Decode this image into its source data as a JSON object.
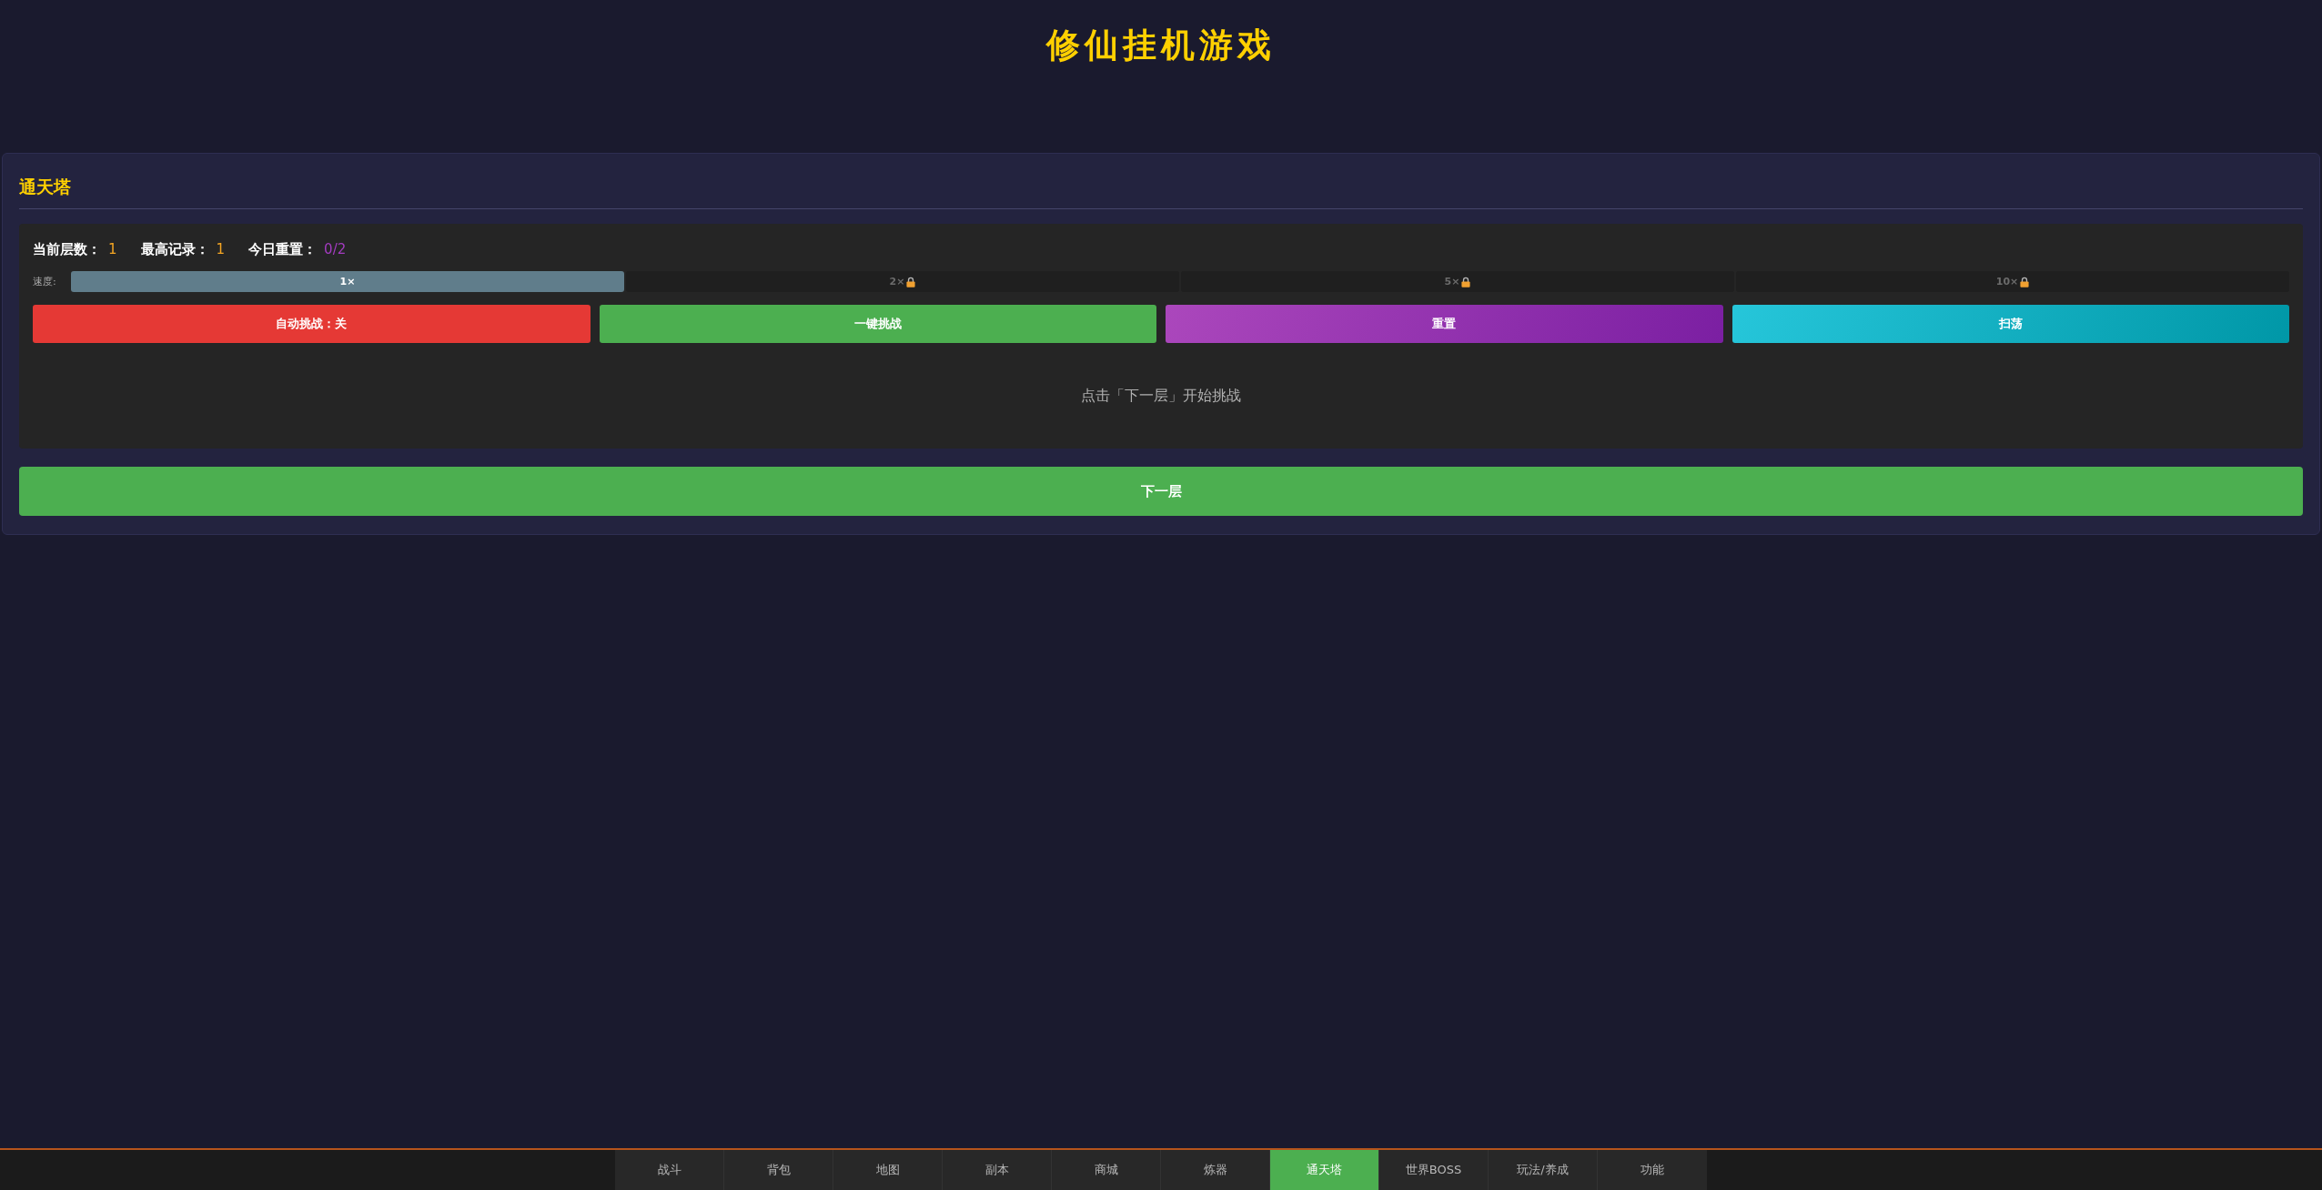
{
  "header": {
    "title": "修仙挂机游戏"
  },
  "panel": {
    "title": "通天塔",
    "stats": [
      {
        "label": "当前层数：",
        "value": "1",
        "kind": "floor"
      },
      {
        "label": "最高记录：",
        "value": "1",
        "kind": "record"
      },
      {
        "label": "今日重置：",
        "value": "0/2",
        "kind": "resets"
      }
    ],
    "speed": {
      "label": "速度:",
      "options": [
        {
          "label": "1×",
          "selected": true,
          "locked": false
        },
        {
          "label": "2×",
          "selected": false,
          "locked": true
        },
        {
          "label": "5×",
          "selected": false,
          "locked": true
        },
        {
          "label": "10×",
          "selected": false,
          "locked": true
        }
      ]
    },
    "actions": [
      {
        "label": "自动挑战：关",
        "kind": "auto"
      },
      {
        "label": "一键挑战",
        "kind": "quick"
      },
      {
        "label": "重置",
        "kind": "reset"
      },
      {
        "label": "扫荡",
        "kind": "sweep"
      }
    ],
    "message": "点击「下一层」开始挑战",
    "next_button": "下一层"
  },
  "nav": {
    "items": [
      {
        "label": "战斗",
        "selected": false
      },
      {
        "label": "背包",
        "selected": false
      },
      {
        "label": "地图",
        "selected": false
      },
      {
        "label": "副本",
        "selected": false
      },
      {
        "label": "商城",
        "selected": false
      },
      {
        "label": "炼器",
        "selected": false
      },
      {
        "label": "通天塔",
        "selected": true
      },
      {
        "label": "世界BOSS",
        "selected": false
      },
      {
        "label": "玩法/养成",
        "selected": false
      },
      {
        "label": "功能",
        "selected": false
      }
    ]
  }
}
